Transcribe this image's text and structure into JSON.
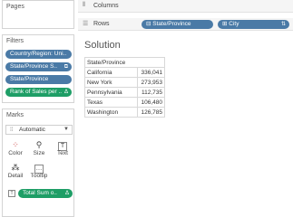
{
  "left": {
    "pages_title": "Pages",
    "filters_title": "Filters",
    "filters": [
      {
        "label": "Country/Region: Uni..",
        "color": "blue",
        "icon": ""
      },
      {
        "label": "State/Province S..",
        "color": "blue",
        "icon": "⧉"
      },
      {
        "label": "State/Province",
        "color": "blue",
        "icon": ""
      },
      {
        "label": "Rank of Sales per ..",
        "color": "green",
        "icon": "Δ"
      }
    ],
    "marks_title": "Marks",
    "marks_type": "Automatic",
    "marks_buttons": [
      "Color",
      "Size",
      "Text",
      "Detail",
      "Tooltip"
    ],
    "marks_pill": {
      "label": "Total Sum o..",
      "icon": "Δ"
    }
  },
  "shelves": {
    "columns_label": "Columns",
    "rows_label": "Rows",
    "rows_pills": [
      {
        "label": "State/Province",
        "icon": "⊟"
      },
      {
        "label": "City",
        "icon": "⊞",
        "sort_icon": "sort-icon"
      }
    ]
  },
  "view": {
    "title": "Solution",
    "header": "State/Province",
    "rows": [
      {
        "name": "California",
        "value": "336,041"
      },
      {
        "name": "New York",
        "value": "273,953"
      },
      {
        "name": "Pennsylvania",
        "value": "112,735"
      },
      {
        "name": "Texas",
        "value": "106,480"
      },
      {
        "name": "Washington",
        "value": "126,785"
      }
    ]
  }
}
